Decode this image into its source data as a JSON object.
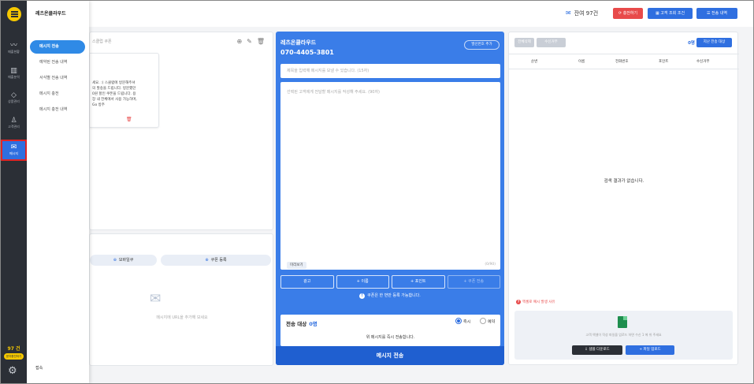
{
  "header": {
    "message_credits": "잔여 97건",
    "charge_label": "충전하기",
    "customer_lookup_label": "고객 조회 조건",
    "send_history_label": "전송 내역"
  },
  "rail": {
    "items": [
      {
        "label": "매출현황",
        "icon": "chart-line-icon"
      },
      {
        "label": "매출분석",
        "icon": "bar-chart-icon"
      },
      {
        "label": "상품관리",
        "icon": "tag-icon"
      },
      {
        "label": "고객관리",
        "icon": "person-icon"
      },
      {
        "label": "메시지",
        "icon": "envelope-icon"
      }
    ],
    "credits": "97 건",
    "charge": "문자충전하기"
  },
  "submenu": {
    "title": "레츠온클라우드",
    "items": [
      "메시지 전송",
      "예약된 전송 내역",
      "서식별 전송 내역",
      "메시지 충전",
      "메시지 충전 내역"
    ],
    "logout": "접속"
  },
  "templates": {
    "tab_text": "스클럽 쿠폰",
    "card_text": "세요. :) 스클럽에 방문해주셔\n의 발송을 드립니다. 방문했던\n0원 할인 쿠폰을 드립니다. 용\n장 내 전체에서 사용 가능하며,\nGo 방주",
    "mobile_ticket": "모바일쿠",
    "coupon_register": "쿠폰 등록",
    "empty_text": "메시지에 URL을 추가해 보세요"
  },
  "composer": {
    "name": "레츠온클라우드",
    "phone": "070-4405-3801",
    "add_number": "발신번호 추가",
    "subject_placeholder": "제목을 입력해 메시지를 보낼 수 있습니다. (15자)",
    "body_placeholder": "선택된 고객에게 전달할 메시지를 작성해 주세요. (90자)",
    "preview": "미리보기",
    "counter": "(0/90)",
    "buttons": [
      "광고",
      "+ 이름",
      "+ 포인트",
      "+ 쿠폰 전송"
    ],
    "coupon_note": "쿠폰은 한 번만 등록 가능합니다.",
    "target_label": "전송 대상",
    "target_count": "0명",
    "radio_now": "즉시",
    "radio_reserve": "예약",
    "target_note": "위 메시지를 즉시 전송합니다.",
    "send": "메시지 전송"
  },
  "recipients": {
    "btn_all": "전체삭제",
    "btn_reject": "수신거부",
    "count": "0명",
    "prev_targets": "지난 전송 대상",
    "columns": [
      "순번",
      "이름",
      "전화번호",
      "포인트",
      "수신거부"
    ],
    "no_result": "검색 결과가 없습니다.",
    "excel_note": "엑셀로 예시 발생 사유",
    "upload_text": "고객 엑셀이 작성 파일을 업로드 하면 수신 1 에 쉬 주세요",
    "sample_download": "샘플 다운로드",
    "file_upload": "파일 업로드"
  }
}
